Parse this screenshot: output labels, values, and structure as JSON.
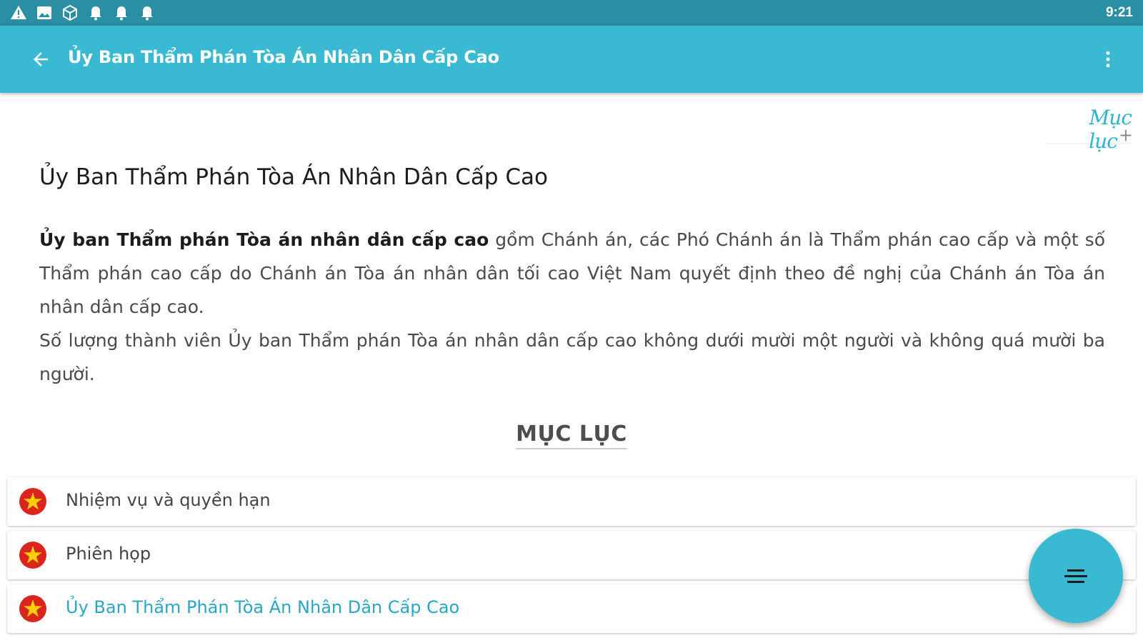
{
  "status_bar": {
    "time": "9:21",
    "icons": [
      "warning-icon",
      "image-icon",
      "cube-icon",
      "bell-icon",
      "bell-icon",
      "bell-icon"
    ]
  },
  "app_bar": {
    "back_icon": "arrow-left-icon",
    "title": "Ủy Ban Thẩm Phán Tòa Án Nhân Dân Cấp Cao",
    "menu_icon": "more-vert-icon",
    "color": "#3ab9d2"
  },
  "toc_link": {
    "label": "Mục lục",
    "plus": "+"
  },
  "article": {
    "title": "Ủy Ban Thẩm Phán Tòa Án Nhân Dân Cấp Cao",
    "para1_bold": "Ủy ban Thẩm phán Tòa án nhân dân cấp cao",
    "para1_rest": " gồm Chánh án, các Phó Chánh án là Thẩm phán cao cấp và một số Thẩm phán cao cấp do Chánh án Tòa án nhân dân tối cao Việt Nam quyết định theo đề nghị của Chánh án Tòa án nhân dân cấp cao.",
    "para2": "Số lượng thành viên Ủy ban Thẩm phán Tòa án nhân dân cấp cao không dưới mười một người và không quá mười ba người."
  },
  "section_heading": "MỤC LỤC",
  "toc_items": [
    {
      "label": "Nhiệm vụ và quyền hạn",
      "icon": "vietnam-flag-icon",
      "active": false
    },
    {
      "label": "Phiên họp",
      "icon": "vietnam-flag-icon",
      "active": false
    },
    {
      "label": "Ủy Ban Thẩm Phán Tòa Án Nhân Dân Cấp Cao",
      "icon": "vietnam-flag-icon",
      "active": true
    }
  ],
  "fab": {
    "icon": "menu-lines-icon"
  },
  "colors": {
    "status_bar": "#2a8fa3",
    "accent": "#3ab9d2",
    "active_text": "#2aa6c2",
    "flag_red": "#da251d",
    "flag_star": "#ffcd00"
  }
}
